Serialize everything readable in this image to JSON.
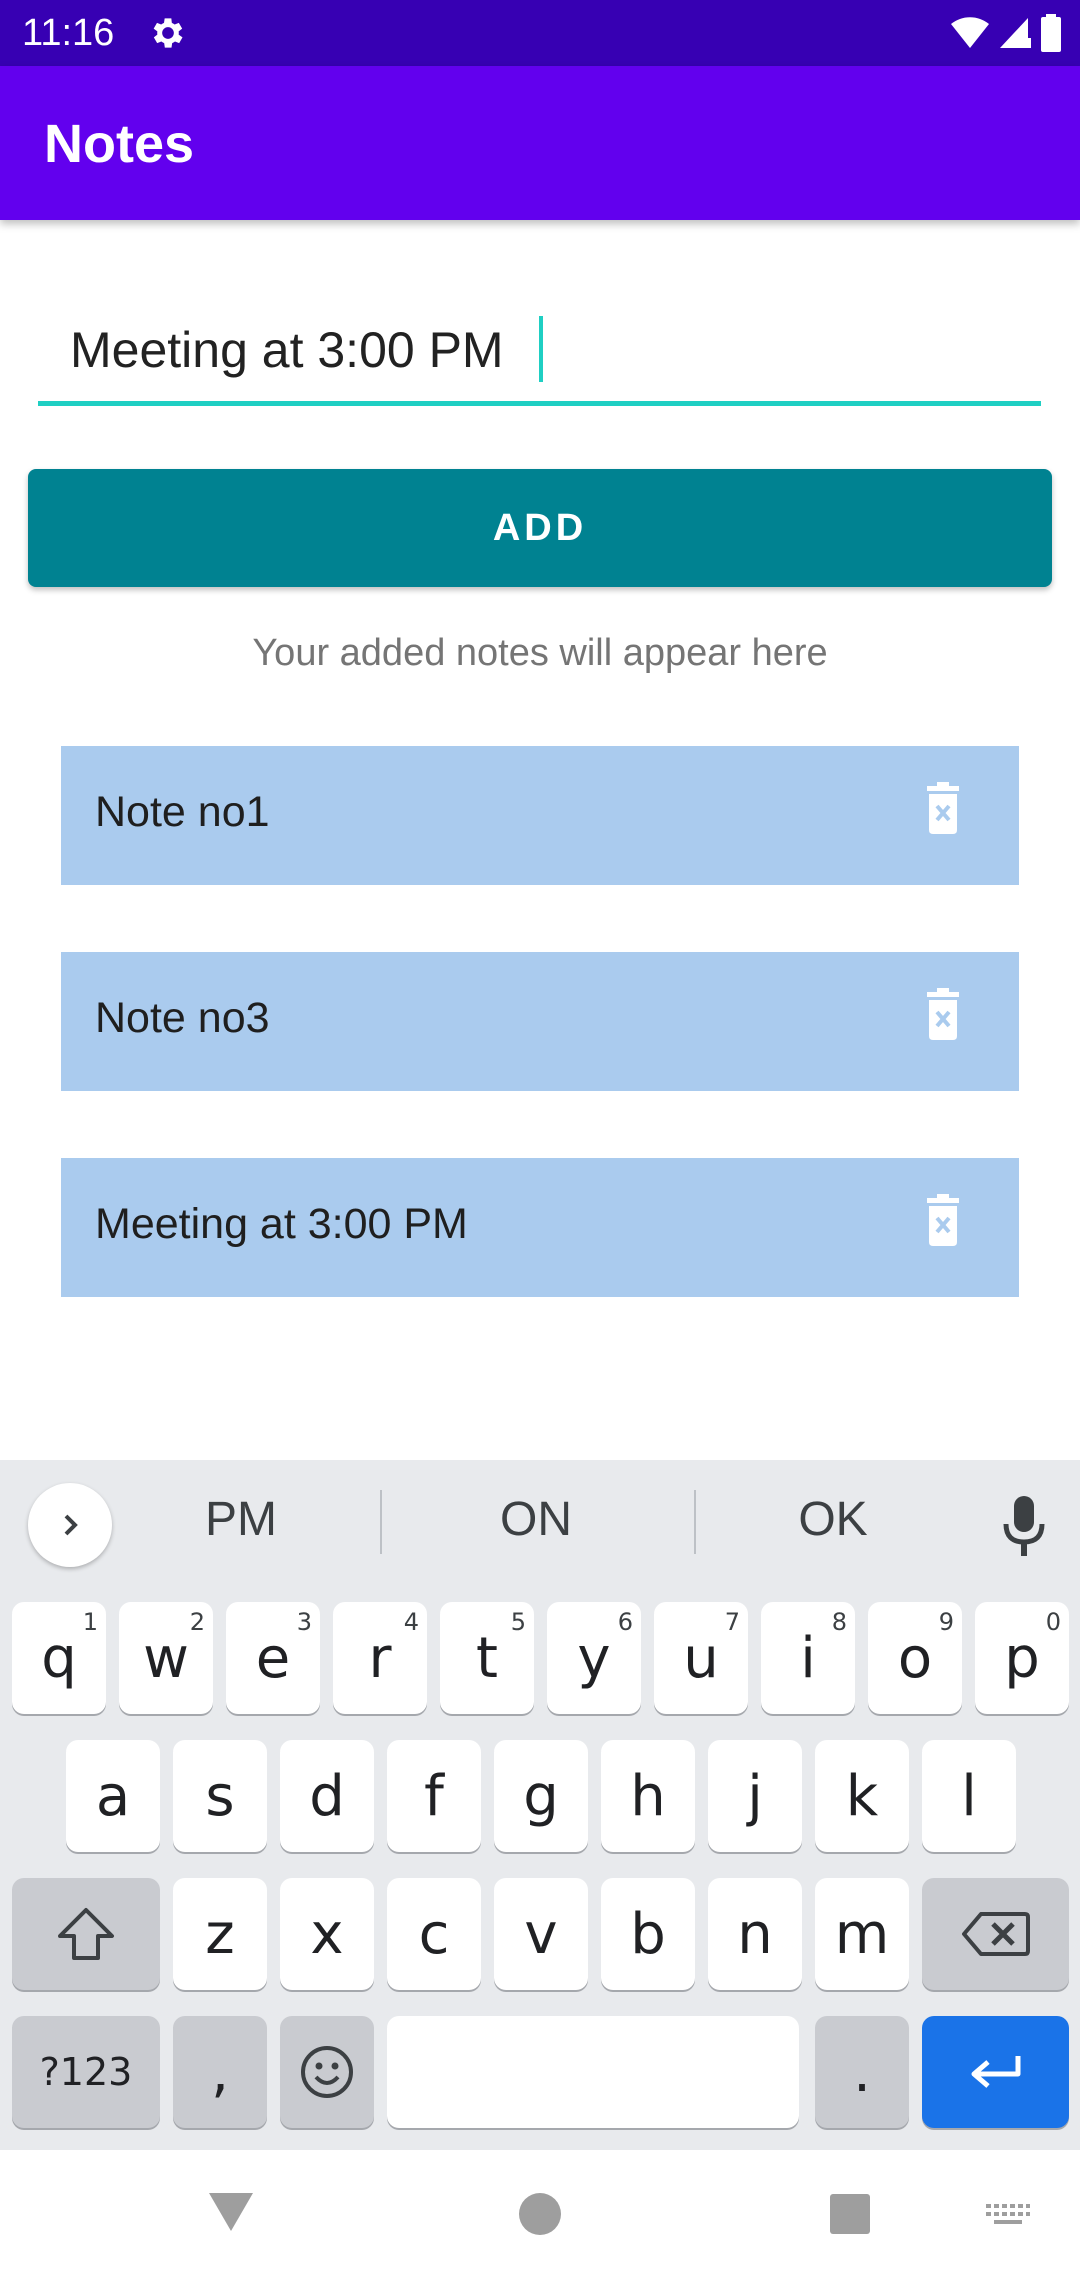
{
  "status_bar": {
    "time": "11:16"
  },
  "app_bar": {
    "title": "Notes"
  },
  "input": {
    "value": "Meeting at 3:00 PM"
  },
  "add_button": {
    "label": "ADD"
  },
  "hint": "Your added notes will appear here",
  "notes": [
    {
      "text": "Note no1"
    },
    {
      "text": "Note no3"
    },
    {
      "text": "Meeting at 3:00 PM"
    }
  ],
  "keyboard": {
    "suggestions": [
      "PM",
      "ON",
      "OK"
    ],
    "row1": [
      {
        "k": "q",
        "h": "1"
      },
      {
        "k": "w",
        "h": "2"
      },
      {
        "k": "e",
        "h": "3"
      },
      {
        "k": "r",
        "h": "4"
      },
      {
        "k": "t",
        "h": "5"
      },
      {
        "k": "y",
        "h": "6"
      },
      {
        "k": "u",
        "h": "7"
      },
      {
        "k": "i",
        "h": "8"
      },
      {
        "k": "o",
        "h": "9"
      },
      {
        "k": "p",
        "h": "0"
      }
    ],
    "row2": [
      "a",
      "s",
      "d",
      "f",
      "g",
      "h",
      "j",
      "k",
      "l"
    ],
    "row3": [
      "z",
      "x",
      "c",
      "v",
      "b",
      "n",
      "m"
    ],
    "symbols_label": "?123",
    "comma": ",",
    "period": "."
  },
  "colors": {
    "status_bar": "#3700b3",
    "app_bar": "#6200ee",
    "accent": "#1fcfc3",
    "add_button": "#008291",
    "note_bg": "#aacbee",
    "enter_key": "#1a73e8"
  }
}
